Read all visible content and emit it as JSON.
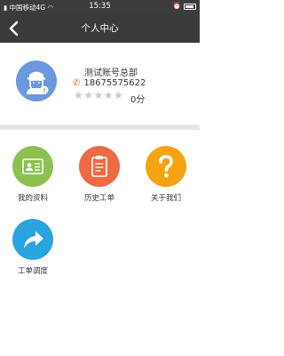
{
  "status_bar": {
    "carrier": "中国移动4G",
    "time": "15:35"
  },
  "header": {
    "title": "个人中心",
    "back_icon": "chevron-left-icon"
  },
  "profile": {
    "name": "测试账号总部",
    "phone": "18675575622",
    "rating_stars": 0,
    "rating_max": 5,
    "score_text": "0分"
  },
  "menu": {
    "items": [
      {
        "label": "我的资料",
        "icon": "id-card-icon",
        "color": "#8cc152"
      },
      {
        "label": "历史工单",
        "icon": "clipboard-icon",
        "color": "#ed6a43"
      },
      {
        "label": "关于我们",
        "icon": "question-icon",
        "color": "#f5a311"
      },
      {
        "label": "工单调度",
        "icon": "share-arrow-icon",
        "color": "#2aa4df"
      }
    ]
  },
  "colors": {
    "status_bar": "#3c3c3c",
    "nav_bar": "#3a3a3a",
    "avatar_bg": "#6b98de",
    "divider": "#e6e6e6"
  }
}
